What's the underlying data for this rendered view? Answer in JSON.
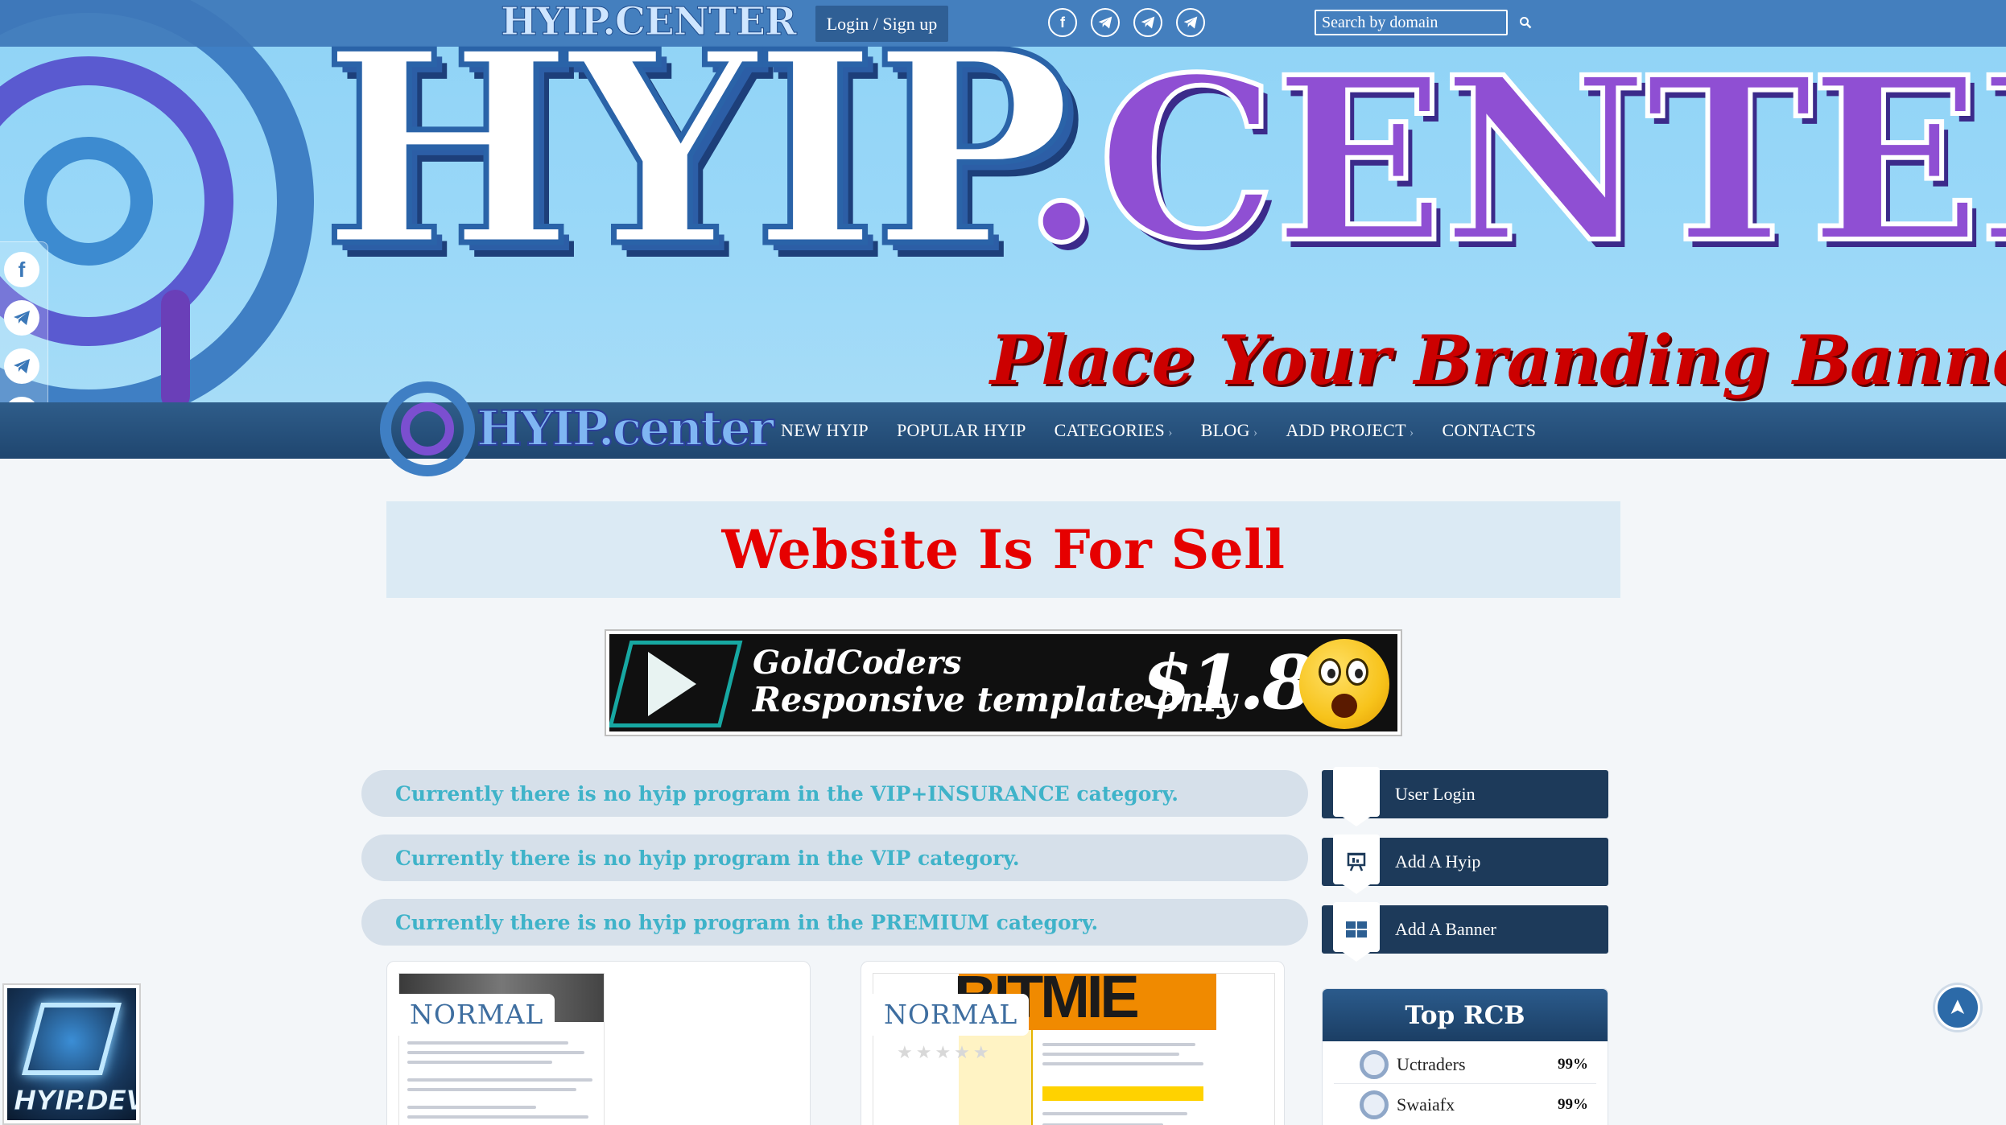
{
  "header": {
    "logo_text": "HYIP.CENTER",
    "login_label": "Login / Sign up",
    "search": {
      "placeholder": "Search by domain",
      "value": ""
    },
    "social": [
      {
        "icon": "facebook-icon",
        "glyph": "f"
      },
      {
        "icon": "telegram-icon",
        "glyph": "➤"
      },
      {
        "icon": "telegram-icon",
        "glyph": "➤"
      },
      {
        "icon": "telegram-icon",
        "glyph": "➤"
      }
    ]
  },
  "hero": {
    "title": "HYIP",
    "domain": ".CENTER",
    "banner_text": "Place Your Branding Banner HER"
  },
  "nav": {
    "logo_text": "HYIP.center",
    "items": [
      {
        "label": "NEW HYIP",
        "has_chevron": false
      },
      {
        "label": "POPULAR HYIP",
        "has_chevron": false
      },
      {
        "label": "CATEGORIES",
        "has_chevron": true
      },
      {
        "label": "BLOG",
        "has_chevron": true
      },
      {
        "label": "ADD PROJECT",
        "has_chevron": true
      },
      {
        "label": "CONTACTS",
        "has_chevron": false
      }
    ]
  },
  "sale": {
    "text": "Website Is For Sell"
  },
  "ad": {
    "line1": "GoldCoders",
    "line2": "Responsive template only",
    "price": "$1.84"
  },
  "categories": [
    {
      "text": "Currently there is no hyip program in the VIP+INSURANCE category."
    },
    {
      "text": "Currently there is no hyip program in the VIP category."
    },
    {
      "text": "Currently there is no hyip program in the PREMIUM category."
    }
  ],
  "cards": [
    {
      "badge": "NORMAL",
      "shot_title": ""
    },
    {
      "badge": "NORMAL",
      "shot_title": "BITMIE"
    }
  ],
  "sidebar": {
    "buttons": [
      {
        "label": "User Login",
        "icon": "user-icon"
      },
      {
        "label": "Add A Hyip",
        "icon": "presentation-icon"
      },
      {
        "label": "Add A Banner",
        "icon": "grid-icon"
      }
    ],
    "top_rcb": {
      "title": "Top RCB",
      "items": [
        {
          "name": "Uctraders",
          "percent": "99%"
        },
        {
          "name": "Swaiafx",
          "percent": "99%"
        }
      ]
    }
  },
  "dev_badge": {
    "text": "HYIP.DEV"
  },
  "colors": {
    "topbar": "#3e77b8",
    "nav": "#1f466f",
    "sale_text": "#e60000",
    "category_text": "#3fb3c9",
    "sidebar_button": "#1d3a5a"
  }
}
